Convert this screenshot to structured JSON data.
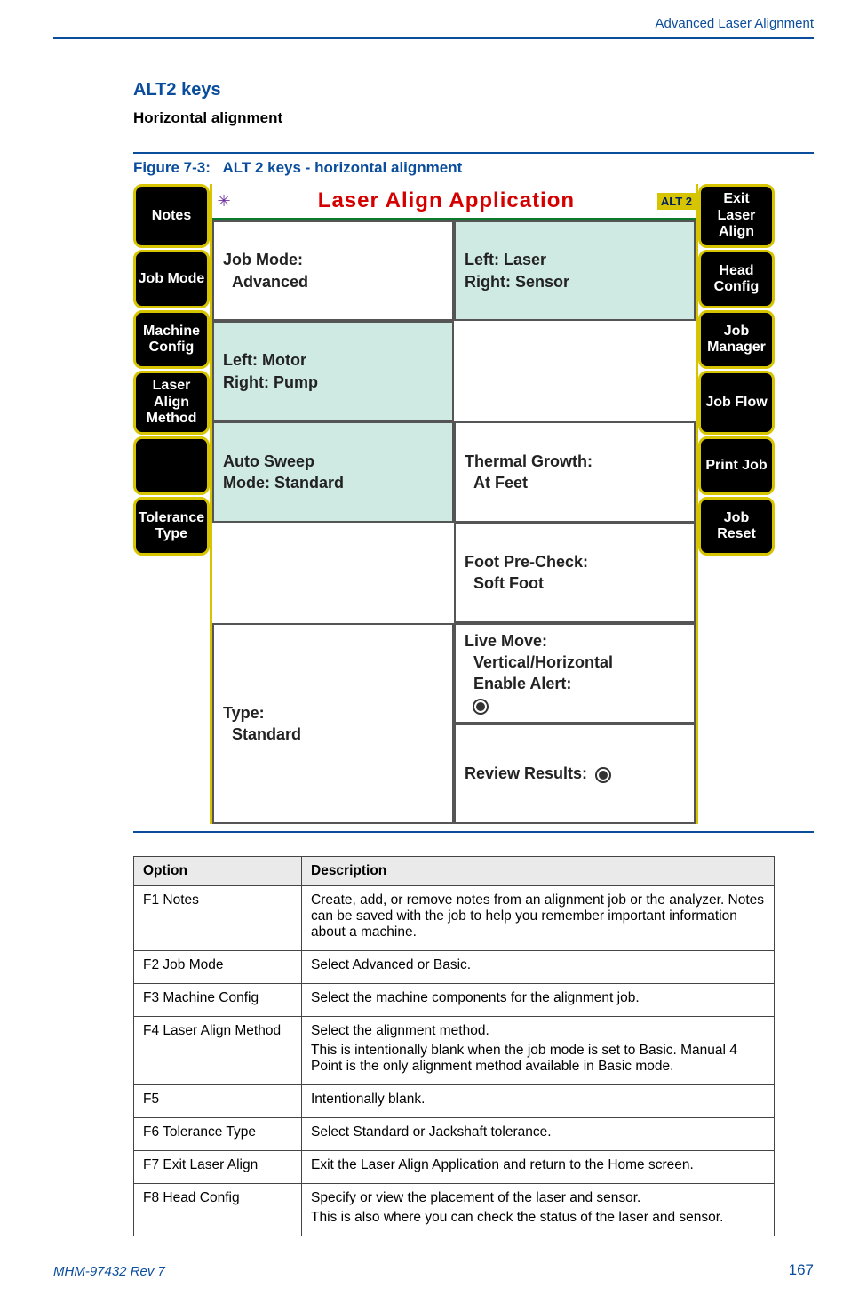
{
  "header": {
    "right": "Advanced Laser Alignment"
  },
  "section": {
    "title": "ALT2 keys",
    "subheading": "Horizontal alignment"
  },
  "figure": {
    "label": "Figure 7-3:",
    "caption": "ALT 2 keys - horizontal alignment"
  },
  "device": {
    "title": "Laser Align Application",
    "alt_badge": "ALT 2",
    "left_buttons": [
      "Notes",
      "Job Mode",
      "Machine Config",
      "Laser Align Method",
      "",
      "Tolerance Type"
    ],
    "right_buttons": [
      "Exit Laser Align",
      "Head Config",
      "Job Manager",
      "Job Flow",
      "Print Job",
      "Job Reset"
    ],
    "cells": {
      "job_mode": "Job Mode:\n  Advanced",
      "head_config": "Left: Laser\nRight: Sensor",
      "machine_config": "Left: Motor\nRight: Pump",
      "auto_sweep": "Auto Sweep\nMode: Standard",
      "thermal": "Thermal Growth:\n  At Feet",
      "foot_precheck": "Foot Pre-Check:\n  Soft Foot",
      "live_move": "Live Move:\n  Vertical/Horizontal\n  Enable Alert:",
      "tolerance": "Type:\n  Standard",
      "review": "Review Results:"
    }
  },
  "table": {
    "headers": [
      "Option",
      "Description"
    ],
    "rows": [
      {
        "option": "F1 Notes",
        "desc": [
          "Create, add, or remove notes from an alignment job or the analyzer. Notes can be saved with the job to help you remember important information about a machine."
        ]
      },
      {
        "option": "F2 Job Mode",
        "desc": [
          "Select Advanced or Basic."
        ]
      },
      {
        "option": "F3 Machine Config",
        "desc": [
          "Select the machine components for the alignment job."
        ]
      },
      {
        "option": "F4 Laser Align Method",
        "desc": [
          "Select the alignment method.",
          "This is intentionally blank when the job mode is set to Basic. Manual 4 Point is the only alignment method available in Basic mode."
        ]
      },
      {
        "option": "F5",
        "desc": [
          "Intentionally blank."
        ]
      },
      {
        "option": "F6 Tolerance Type",
        "desc": [
          "Select Standard or Jackshaft tolerance."
        ]
      },
      {
        "option": "F7 Exit Laser Align",
        "desc": [
          "Exit the Laser Align Application and return to the Home screen."
        ]
      },
      {
        "option": "F8 Head Config",
        "desc": [
          "Specify or view the placement of the laser and sensor.",
          "This is also where you can check the status of the laser and sensor."
        ]
      }
    ]
  },
  "footer": {
    "left": "MHM-97432 Rev 7",
    "right": "167"
  }
}
